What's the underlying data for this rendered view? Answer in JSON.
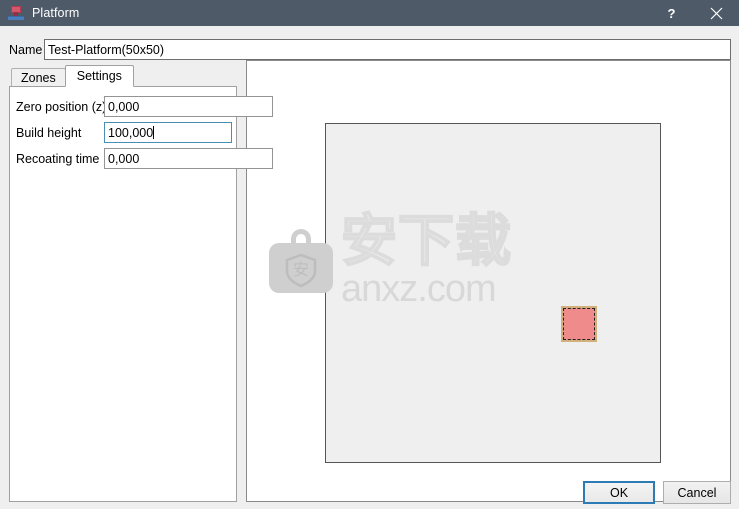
{
  "window": {
    "title": "Platform",
    "icon": "platform-icon",
    "help_label": "?",
    "close_label": "✕"
  },
  "name_field": {
    "label": "Name",
    "value": "Test-Platform(50x50)",
    "placeholder": ""
  },
  "tabs": [
    {
      "label": "Zones",
      "active": false
    },
    {
      "label": "Settings",
      "active": true
    }
  ],
  "settings": {
    "fields": [
      {
        "label": "Zero position (z)",
        "value": "0,000",
        "focused": false
      },
      {
        "label": "Build height",
        "value": "100,000",
        "focused": true
      },
      {
        "label": "Recoating time",
        "value": "0,000",
        "focused": false
      }
    ]
  },
  "viewport": {
    "platform_name": "platform-outline",
    "zone_name": "build-zone",
    "platform_fill": "#efefef",
    "platform_border": "#555555",
    "zone_fill": "#ef8b8b",
    "zone_border": "#d2b07a"
  },
  "watermark": {
    "cn_text": "安下载",
    "en_text": "anxz.com",
    "logo_glyph": "安"
  },
  "buttons": {
    "ok": "OK",
    "cancel": "Cancel"
  },
  "colors": {
    "titlebar": "#4e5a68",
    "accent": "#2d7bb5",
    "focus_border": "#4a8db5",
    "dialog_bg": "#efefef"
  }
}
